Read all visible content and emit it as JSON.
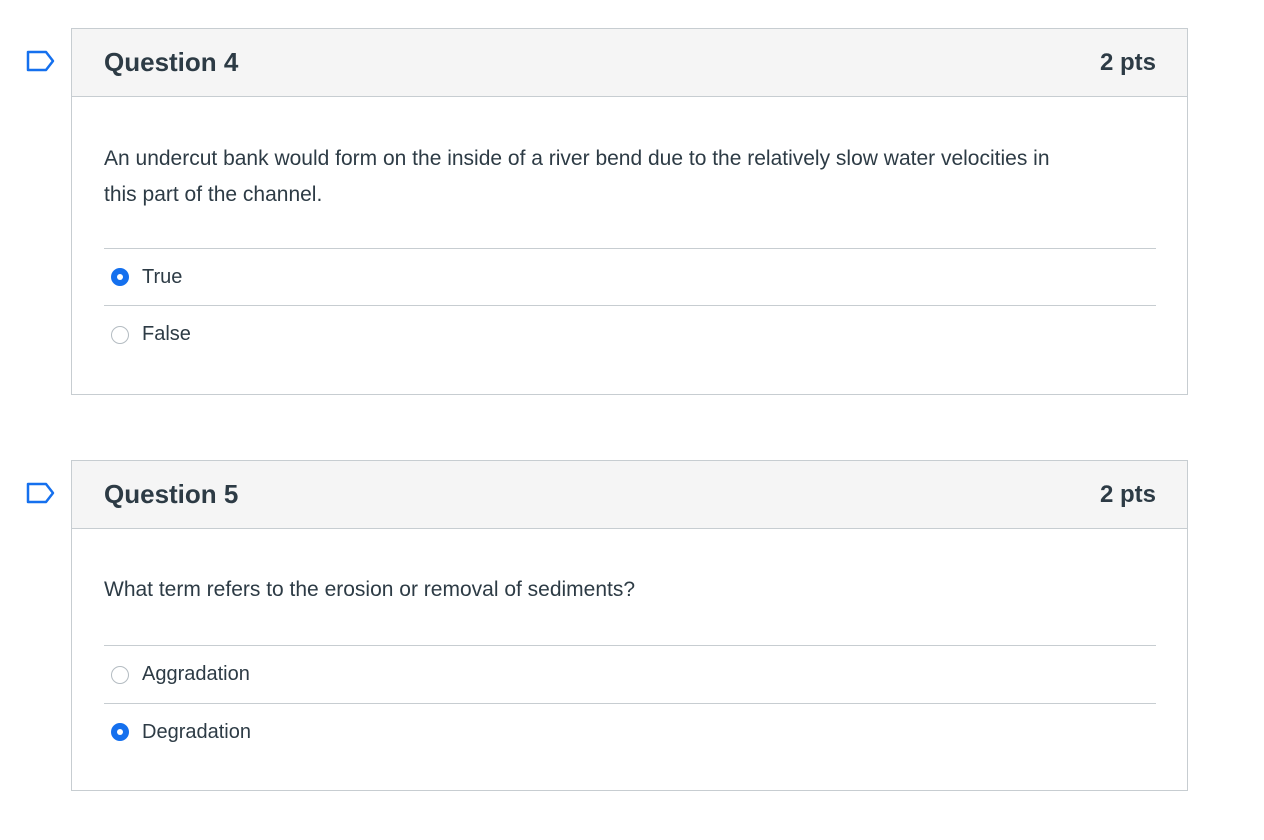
{
  "questions": [
    {
      "title": "Question 4",
      "points": "2 pts",
      "text": "An undercut bank would form on the inside of a river bend due to the relatively slow water velocities in this part of the channel.",
      "answers": [
        {
          "label": "True",
          "selected": true
        },
        {
          "label": "False",
          "selected": false
        }
      ]
    },
    {
      "title": "Question 5",
      "points": "2 pts",
      "text": "What term refers to the erosion or removal of sediments?",
      "answers": [
        {
          "label": "Aggradation",
          "selected": false
        },
        {
          "label": "Degradation",
          "selected": true
        }
      ]
    }
  ],
  "icons": {
    "flag": "flag-bookmark-icon"
  },
  "colors": {
    "accent": "#1570ee",
    "header_bg": "#f5f5f5",
    "border": "#c7cdd1",
    "text": "#2d3b45"
  }
}
